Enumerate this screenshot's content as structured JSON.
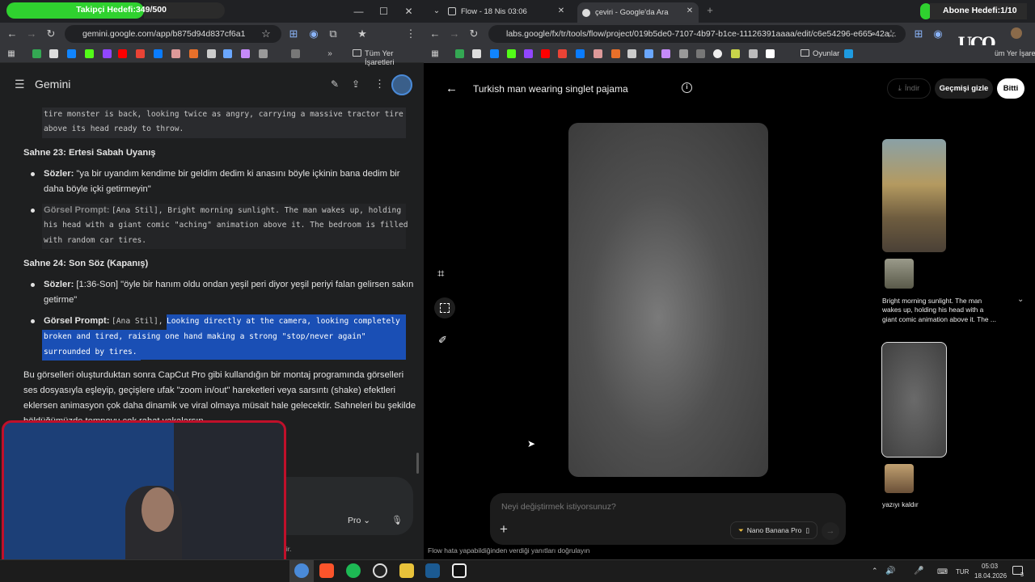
{
  "overlay": {
    "follower_goal": "Takipçi Hedefi:349/500",
    "subscriber_goal": "Abone Hedefi:1/10",
    "logo_text": "UCO"
  },
  "left_browser": {
    "url": "gemini.google.com/app/b875d94d837cf6a1",
    "bookmarks_label": "Tüm Yer İşaretleri"
  },
  "gemini": {
    "title": "Gemini",
    "prompt_partial_1": "tire monster is back, looking twice as angry, carrying a massive tractor tire",
    "prompt_partial_2": "above its head ready to throw.",
    "scene23": {
      "heading": "Sahne 23: Ertesi Sabah Uyanış",
      "lyrics_label": "Sözler:",
      "lyrics_1": " \"ya bir uyandım kendime bir geldim dedim ki anasını böyle içkinin bana dedim bir",
      "lyrics_2": "daha böyle içki getirmeyin\"",
      "prompt_label": "Görsel Prompt:",
      "prompt_1": "[Ana Stil], Bright morning sunlight. The man wakes up, holding",
      "prompt_2": "his head with a giant comic \"aching\" animation above it. The bedroom is filled",
      "prompt_3": "with random car tires."
    },
    "scene24": {
      "heading": "Sahne 24: Son Söz (Kapanış)",
      "lyrics_label": "Sözler:",
      "lyrics_1": " [1:36-Son] \"öyle bir hanım oldu ondan yeşil peri diyor yeşil periyi falan gelirsen sakın",
      "lyrics_2": "getirme\"",
      "prompt_label": "Görsel Prompt:",
      "prompt_1a": "[Ana Stil],",
      "prompt_1b": "Looking directly at the camera, looking completely",
      "prompt_2": "broken and tired, raising one hand making a strong \"stop/never again\" gesture,",
      "prompt_3": "surrounded by tires."
    },
    "outro_1": "Bu görselleri oluşturduktan sonra CapCut Pro gibi kullandığın bir montaj programında görselleri",
    "outro_2": "ses dosyasıyla eşleyip, geçişlere ufak \"zoom in/out\" hareketleri veya sarsıntı (shake) efektleri",
    "outro_3": "eklersen animasyon çok daha dinamik ve viral olmaya müsait hale gelecektir. Sahneleri bu şekilde",
    "outro_4": "böldüğümüzde tempoyu çok rahat yakalarsın.",
    "model_selector": "Pro",
    "disclaimer_tail": "lir."
  },
  "right_browser": {
    "tab1": "Flow - 18 Nis 03:06",
    "tab2": "çeviri - Google'da Ara",
    "url": "labs.google/fx/tr/tools/flow/project/019b5de0-7107-4b97-b1ce-11126391aaaa/edit/c6e54296-e665-42a...",
    "bm_folder": "Oyunlar",
    "bm_tail": "üm Yer İşaretle"
  },
  "flow": {
    "title": "Turkish man wearing singlet pajama",
    "download": "İndir",
    "hide_history": "Geçmişi gizle",
    "done": "Bitti",
    "edit_placeholder": "Neyi değiştirmek istiyorsunuz?",
    "model": "Nano Banana Pro",
    "footer": "Flow hata yapabildiğinden verdiği yanıtları doğrulayın",
    "history_caption_1": "Bright morning sunlight. The man",
    "history_caption_2": "wakes up, holding his head with a",
    "history_caption_3": "giant comic  animation above it. The ...",
    "history_caption_2b": "yazıyı kaldır"
  },
  "taskbar": {
    "lang": "TUR",
    "time": "05:03",
    "date": "18.04.2026",
    "notif_count": "3"
  },
  "colors": {
    "overlay_green": "#2fd12f",
    "highlight_blue": "#1a4fb5",
    "webcam_border": "#c0102a"
  }
}
